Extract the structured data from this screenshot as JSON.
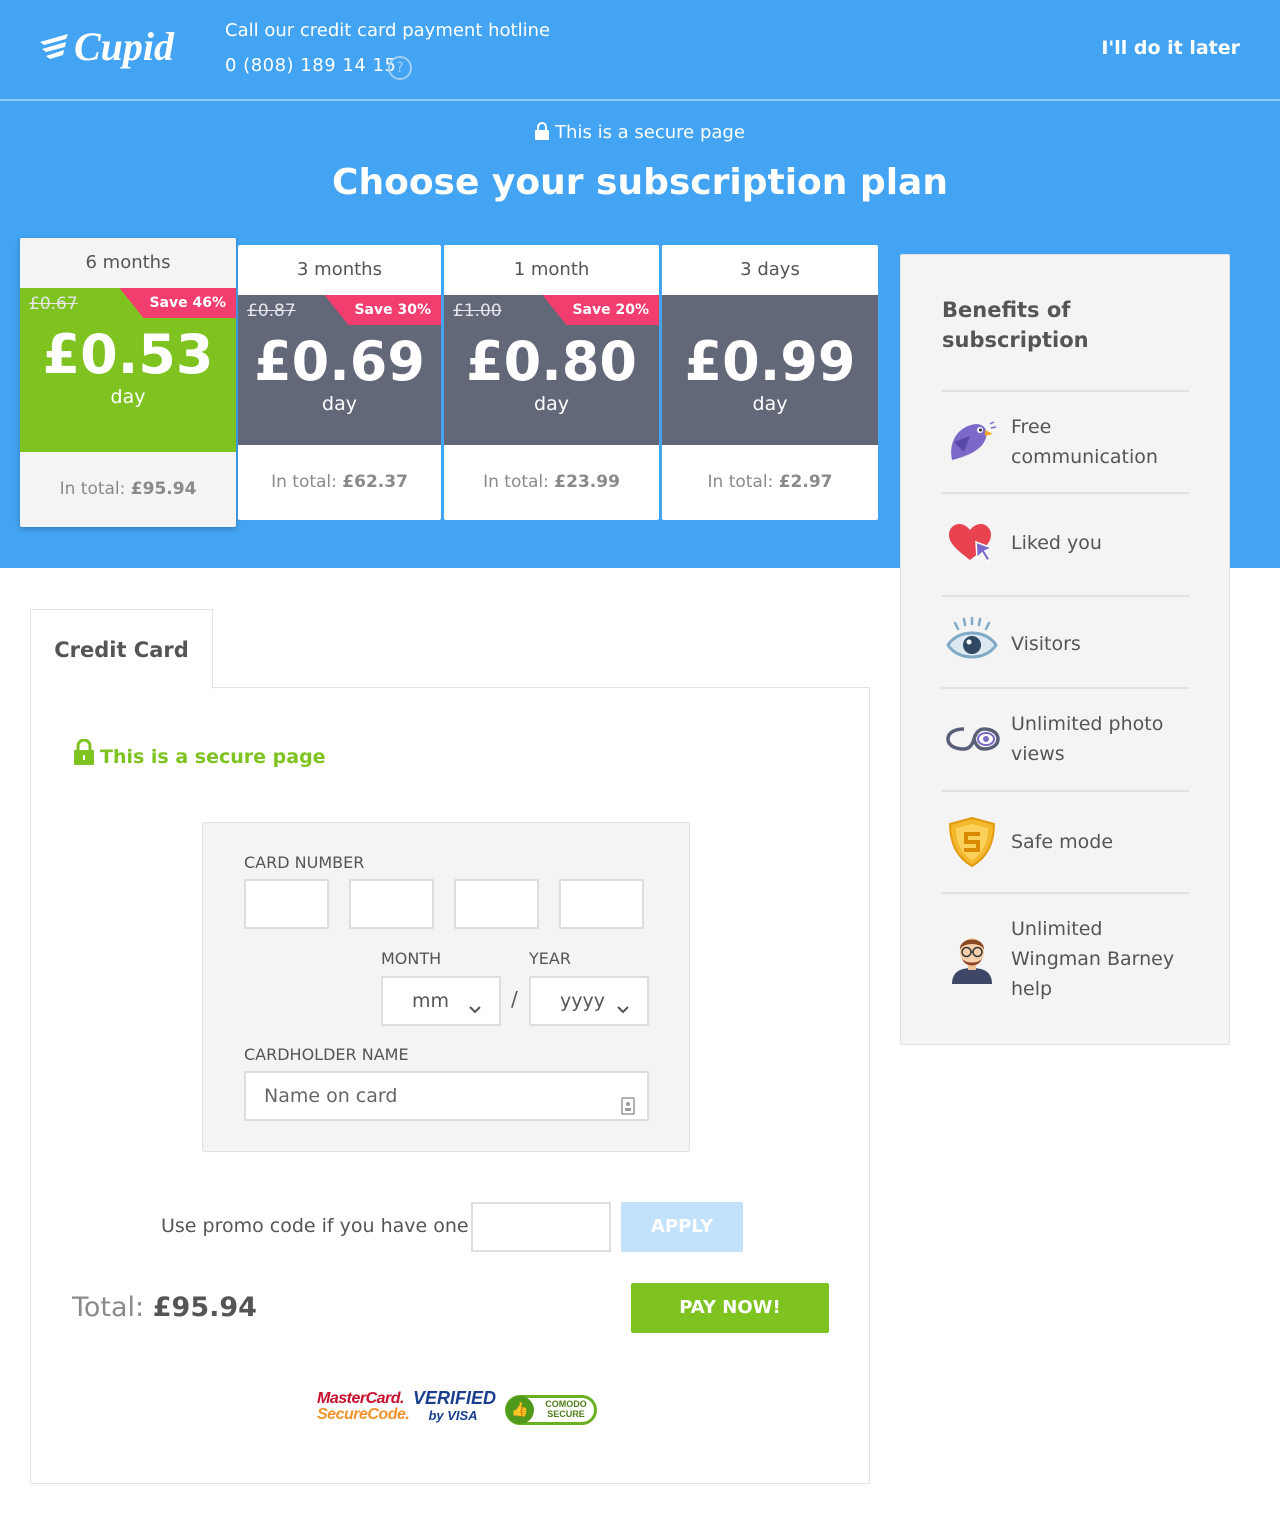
{
  "header": {
    "brand": "Cupid",
    "hotline_label": "Call our credit card payment hotline",
    "hotline_number": "0 (808) 189 14 15",
    "help_icon": "?",
    "later_link": "I'll do it later"
  },
  "hero": {
    "secure_text": "This is a secure page",
    "title": "Choose your subscription plan"
  },
  "plans": [
    {
      "duration": "6 months",
      "old_price": "£0.67",
      "save": "Save 46%",
      "price": "£0.53",
      "unit": "day",
      "total_label": "In total:",
      "total": "£95.94",
      "selected": true
    },
    {
      "duration": "3 months",
      "old_price": "£0.87",
      "save": "Save 30%",
      "price": "£0.69",
      "unit": "day",
      "total_label": "In total:",
      "total": "£62.37",
      "selected": false
    },
    {
      "duration": "1 month",
      "old_price": "£1.00",
      "save": "Save 20%",
      "price": "£0.80",
      "unit": "day",
      "total_label": "In total:",
      "total": "£23.99",
      "selected": false
    },
    {
      "duration": "3 days",
      "old_price": "",
      "save": "",
      "price": "£0.99",
      "unit": "day",
      "total_label": "In total:",
      "total": "£2.97",
      "selected": false
    }
  ],
  "benefits": {
    "title": "Benefits of subscription",
    "items": [
      {
        "label": "Free communication",
        "icon": "bird-icon"
      },
      {
        "label": "Liked you",
        "icon": "heart-cursor-icon"
      },
      {
        "label": "Visitors",
        "icon": "eye-icon"
      },
      {
        "label": "Unlimited photo views",
        "icon": "infinity-eye-icon"
      },
      {
        "label": "Safe mode",
        "icon": "shield-icon"
      },
      {
        "label": "Unlimited Wingman Barney help",
        "icon": "wingman-avatar-icon"
      }
    ]
  },
  "payment": {
    "tab_label": "Credit Card",
    "secure_text": "This is a secure page",
    "card_number_label": "CARD NUMBER",
    "month_label": "MONTH",
    "year_label": "YEAR",
    "month_value": "mm",
    "year_value": "yyyy",
    "separator": "/",
    "cardholder_label": "CARDHOLDER NAME",
    "cardholder_placeholder": "Name on card",
    "promo_label": "Use promo code if you have one",
    "apply_label": "APPLY",
    "total_label": "Total:",
    "total_value": "£95.94",
    "pay_label": "PAY NOW!"
  },
  "trust_seals": {
    "mastercard_line1": "MasterCard.",
    "mastercard_line2": "SecureCode.",
    "visa_line1": "VERIFIED",
    "visa_line2": "by VISA",
    "comodo_line1": "COMODO",
    "comodo_line2": "SECURE"
  },
  "colors": {
    "brand_blue": "#42a4f2",
    "selected_green": "#7ec320",
    "plan_dark": "#636879",
    "save_pink": "#f23d6f",
    "apply_disabled": "#c2e1fb"
  }
}
